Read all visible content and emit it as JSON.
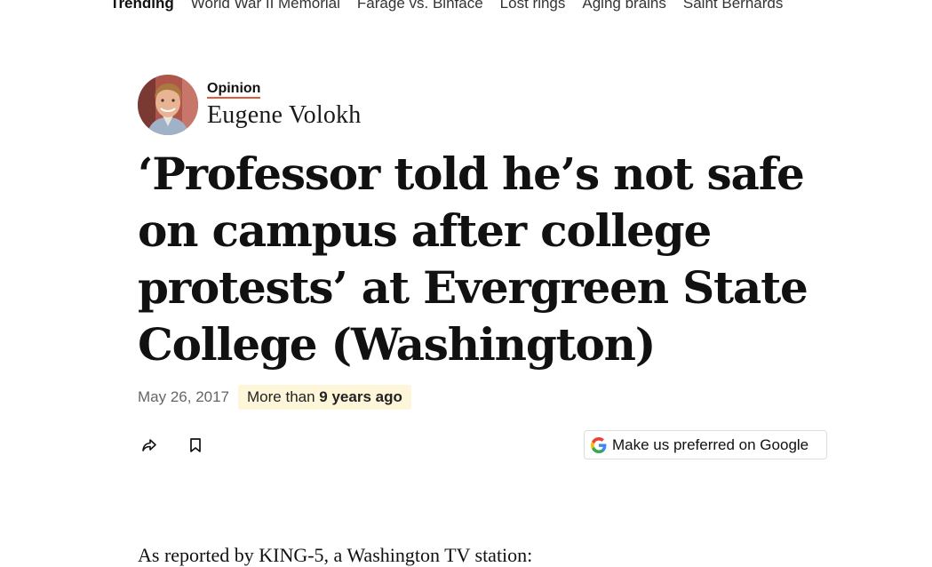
{
  "trending": {
    "label": "Trending",
    "items": [
      "World War II Memorial",
      "Farage vs. Binface",
      "Lost rings",
      "Aging brains",
      "Saint Bernards"
    ]
  },
  "byline": {
    "section": "Opinion",
    "author": "Eugene Volokh"
  },
  "headline": "‘Professor told he’s not safe on campus after college protests’ at Evergreen State College (Washington)",
  "meta": {
    "date": "May 26, 2017",
    "age_prefix": "More than ",
    "age_value": "9 years ago"
  },
  "actions": {
    "share_icon": "share-icon",
    "bookmark_icon": "bookmark-icon"
  },
  "google_pref": {
    "label": "Make us preferred on Google"
  },
  "article": {
    "first_paragraph": "As reported by KING-5, a Washington TV station:"
  },
  "colors": {
    "section_underline": "#e05a3a",
    "age_badge_bg": "#fdf6d8"
  }
}
